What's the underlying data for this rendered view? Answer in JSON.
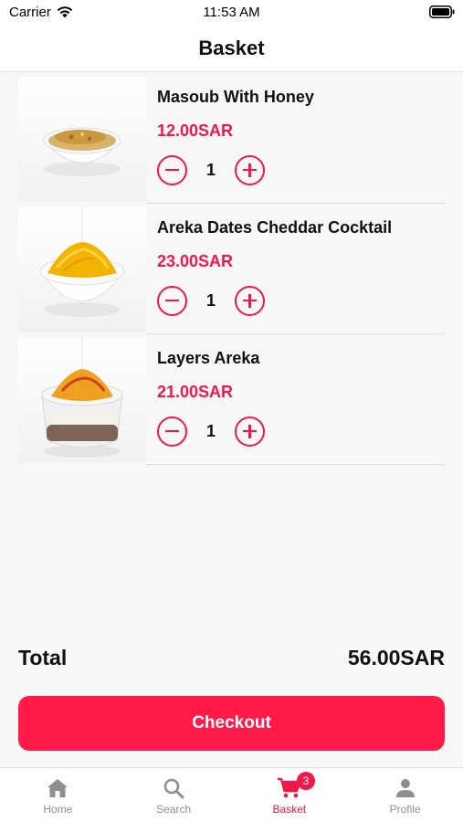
{
  "status_bar": {
    "carrier": "Carrier",
    "time": "11:53 AM"
  },
  "header": {
    "title": "Basket"
  },
  "items": [
    {
      "name": "Masoub With Honey",
      "price": "12.00SAR",
      "quantity": "1"
    },
    {
      "name": "Areka Dates Cheddar Cocktail",
      "price": "23.00SAR",
      "quantity": "1"
    },
    {
      "name": "Layers Areka",
      "price": "21.00SAR",
      "quantity": "1"
    }
  ],
  "summary": {
    "total_label": "Total",
    "total_value": "56.00SAR"
  },
  "checkout": {
    "label": "Checkout"
  },
  "tabs": [
    {
      "label": "Home",
      "icon": "home-icon"
    },
    {
      "label": "Search",
      "icon": "search-icon"
    },
    {
      "label": "Basket",
      "icon": "cart-icon",
      "badge": "3"
    },
    {
      "label": "Profile",
      "icon": "person-icon"
    }
  ],
  "colors": {
    "accent": "#f0174a",
    "button": "#ff1a4a",
    "inactive": "#8e8e93"
  }
}
